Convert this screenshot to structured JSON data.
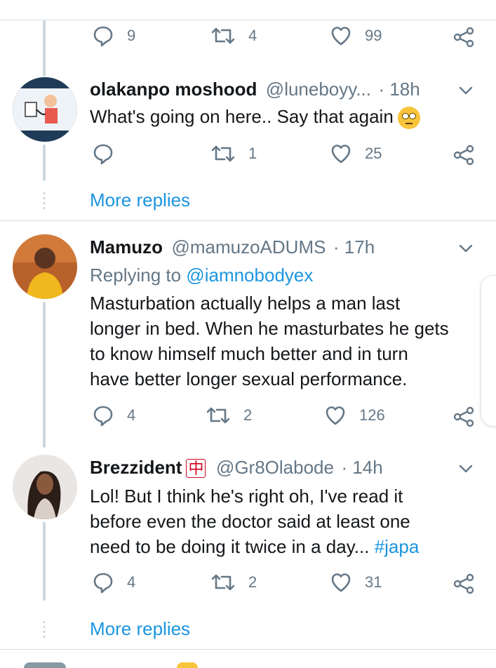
{
  "top_actions": {
    "replies": "9",
    "retweets": "4",
    "likes": "99"
  },
  "tweets": [
    {
      "name": "olakanpo moshood",
      "handle": "@luneboyy...",
      "time": "· 18h",
      "text": "What's going on here.. Say that again",
      "emoji": "face-with-rolling-eyes",
      "replies": "",
      "retweets": "1",
      "likes": "25",
      "more_replies": "More replies"
    },
    {
      "name": "Mamuzo",
      "handle": "@mamuzoADUMS",
      "time": "· 17h",
      "replying_prefix": "Replying to",
      "replying_handle": "@iamnobodyex",
      "text_lines": [
        "Masturbation actually helps a man last",
        "longer in bed. When he masturbates he gets",
        "to know himself much better and in turn",
        "have better longer sexual performance."
      ],
      "replies": "4",
      "retweets": "2",
      "likes": "126"
    },
    {
      "name": "Brezzident",
      "badge": "中",
      "handle": "@Gr8Olabode",
      "time": "· 14h",
      "text_lines": [
        "Lol! But I think he's right oh, I've read it",
        "before even the doctor said at least one",
        "need to be doing it twice in a day..."
      ],
      "hashtag": "#japa",
      "replies": "4",
      "retweets": "2",
      "likes": "31",
      "more_replies": "More replies"
    }
  ],
  "colors": {
    "accent": "#1b95e0",
    "muted": "#657786",
    "divider": "#d8dde2",
    "thread": "#ccd6dd"
  }
}
